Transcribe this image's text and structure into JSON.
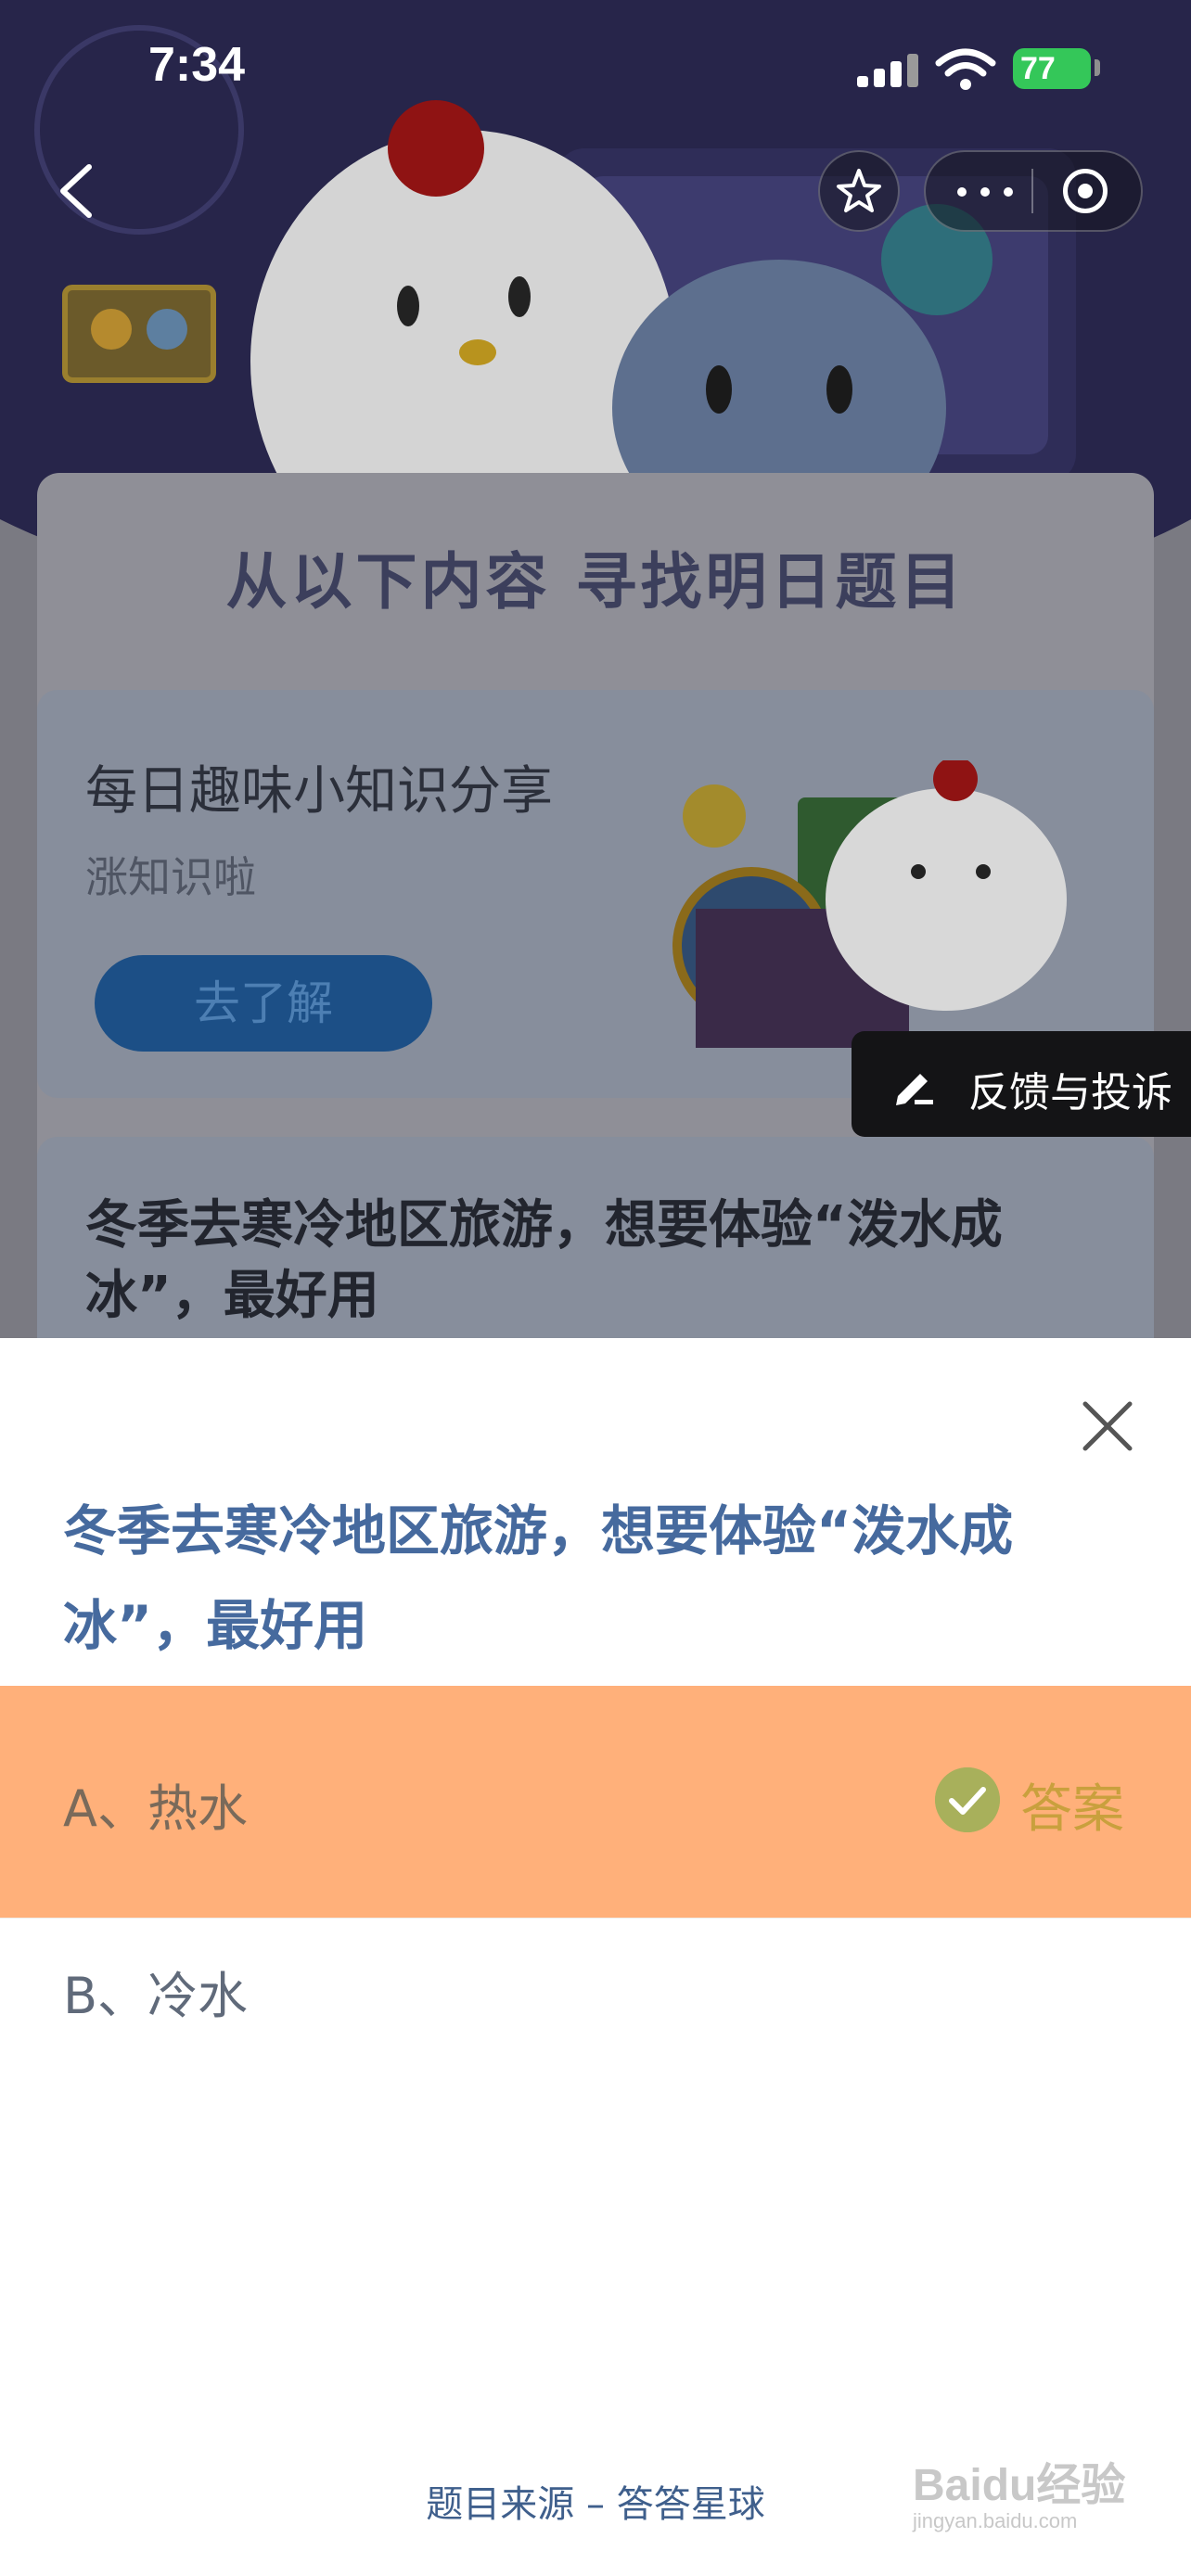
{
  "status_bar": {
    "time": "7:34",
    "battery": "77"
  },
  "panel": {
    "title": "从以下内容 寻找明日题目"
  },
  "card1": {
    "title": "每日趣味小知识分享",
    "subtitle": "涨知识啦",
    "button": "去了解"
  },
  "feedback": {
    "label": "反馈与投诉"
  },
  "card2": {
    "title": "冬季去寒冷地区旅游，想要体验“泼水成冰”，最好用"
  },
  "sheet": {
    "question": "冬季去寒冷地区旅游，想要体验“泼水成冰”，最好用",
    "options": [
      {
        "label": "A、热水",
        "selected": true,
        "badge": "答案"
      },
      {
        "label": "B、冷水",
        "selected": false
      }
    ],
    "source": "题目来源 – 答答星球"
  },
  "watermark": {
    "brand": "Baidu经验",
    "url": "jingyan.baidu.com"
  },
  "colors": {
    "hero_bg": "#27254a",
    "answer_highlight": "#ffb07a",
    "question_text": "#466a9e",
    "feedback_bg": "#141416"
  }
}
